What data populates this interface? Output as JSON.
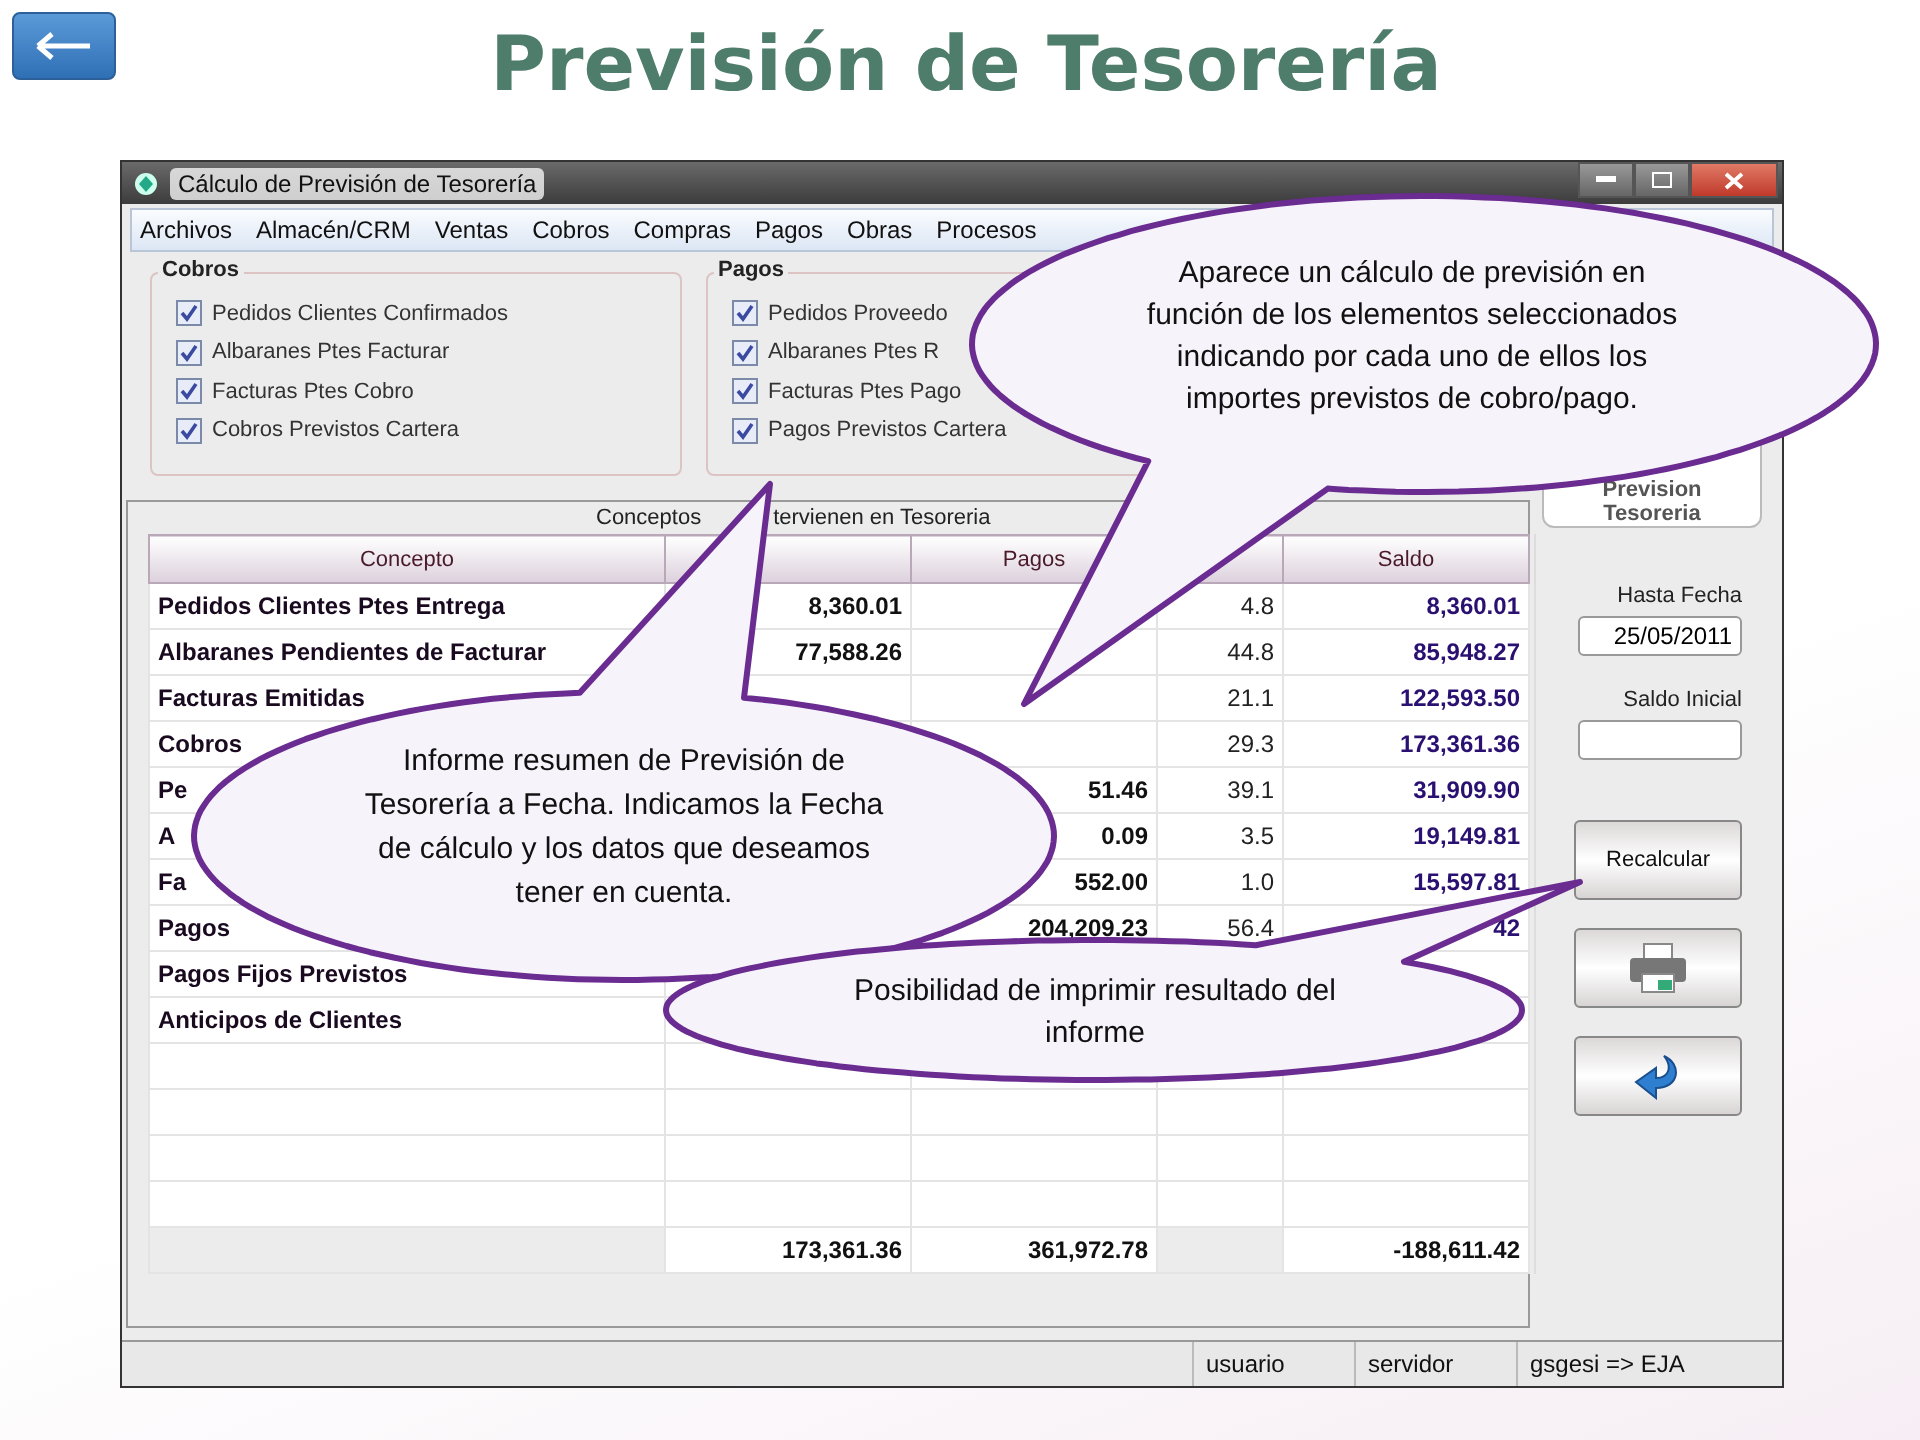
{
  "slide": {
    "title": "Previsión de Tesorería"
  },
  "window": {
    "title": "Cálculo de Previsión de Tesorería"
  },
  "menu": [
    "Archivos",
    "Almacén/CRM",
    "Ventas",
    "Cobros",
    "Compras",
    "Pagos",
    "Obras",
    "Procesos"
  ],
  "groups": [
    {
      "title": "Cobros",
      "items": [
        {
          "label": "Pedidos Clientes Confirmados",
          "checked": true
        },
        {
          "label": "Albaranes Ptes Facturar",
          "checked": true
        },
        {
          "label": "Facturas Ptes Cobro",
          "checked": true
        },
        {
          "label": "Cobros Previstos Cartera",
          "checked": true
        }
      ]
    },
    {
      "title": "Pagos",
      "items": [
        {
          "label": "Pedidos Proveedo",
          "checked": true
        },
        {
          "label": "Albaranes Ptes R",
          "checked": true
        },
        {
          "label": "Facturas Ptes Pago",
          "checked": true
        },
        {
          "label": "Pagos Previstos Cartera",
          "checked": true
        }
      ]
    }
  ],
  "logo": {
    "caption": "Prevision Tesoreria"
  },
  "grid": {
    "title_parts": [
      "Conceptos",
      "tervienen en Tesoreria"
    ],
    "columns": [
      "Concepto",
      null,
      "Pagos",
      null,
      "Saldo"
    ],
    "rows": [
      {
        "concepto": "Pedidos Clientes Ptes Entrega",
        "cobros": "8,360.01",
        "pct": "4.8",
        "saldo": "8,360.01"
      },
      {
        "concepto": "Albaranes Pendientes de Facturar",
        "cobros": "77,588.26",
        "pct": "44.8",
        "saldo": "85,948.27"
      },
      {
        "concepto": "Facturas Emitidas",
        "pct": "21.1",
        "saldo": "122,593.50"
      },
      {
        "concepto": "Cobros",
        "pct": "29.3",
        "saldo": "173,361.36"
      },
      {
        "concepto": "Pe",
        "pagos": "51.46",
        "pct": "39.1",
        "saldo": "31,909.90"
      },
      {
        "concepto": "A",
        "pagos": "0.09",
        "pct": "3.5",
        "saldo": "19,149.81"
      },
      {
        "concepto": "Fa",
        "pagos": "552.00",
        "pct": "1.0",
        "saldo": "15,597.81"
      },
      {
        "concepto": "Pagos",
        "pagos": "204,209.23",
        "pct": "56.4",
        "saldo": "42"
      },
      {
        "concepto": "Pagos Fijos Previstos"
      },
      {
        "concepto": "Anticipos de Clientes"
      }
    ],
    "totals": {
      "cobros": "173,361.36",
      "pagos": "361,972.78",
      "saldo": "-188,611.42"
    }
  },
  "side": {
    "date_label": "Hasta Fecha",
    "date_value": "25/05/2011",
    "balance_label": "Saldo Inicial",
    "recalc_button": "Recalcular"
  },
  "status_bar": [
    "usuario",
    "servidor",
    "gsgesi => EJA"
  ],
  "callouts": [
    {
      "text": "Aparece un cálculo de previsión en función de los elementos seleccionados indicando por cada uno de ellos los importes previstos de cobro/pago."
    },
    {
      "text": "Informe resumen de Previsión de Tesorería a Fecha. Indicamos la Fecha de cálculo y los datos que deseamos tener en cuenta."
    },
    {
      "text": "Posibilidad de imprimir resultado del informe"
    }
  ]
}
